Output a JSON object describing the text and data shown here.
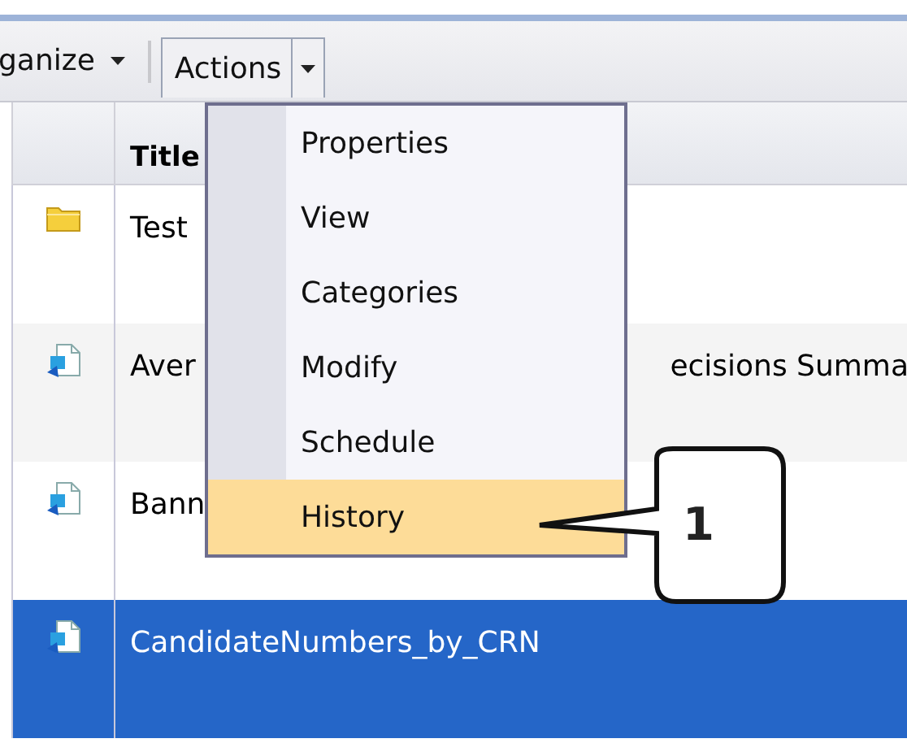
{
  "toolbar": {
    "buttons": [
      {
        "label": "ganize",
        "kind": "dropdown"
      },
      {
        "label": "Actions",
        "kind": "split"
      }
    ]
  },
  "table": {
    "columns": [
      "Title"
    ],
    "rows": [
      {
        "kind": "folder",
        "title": "Test",
        "selected": false
      },
      {
        "kind": "report",
        "title": "Aver",
        "title_right": "ecisions Summa",
        "selected": false
      },
      {
        "kind": "report",
        "title": "Bann",
        "selected": false
      },
      {
        "kind": "report",
        "title": "CandidateNumbers_by_CRN",
        "selected": true
      }
    ]
  },
  "menu": {
    "items": [
      {
        "label": "Properties",
        "selected": false
      },
      {
        "label": "View",
        "selected": false
      },
      {
        "label": "Categories",
        "selected": false
      },
      {
        "label": "Modify",
        "selected": false
      },
      {
        "label": "Schedule",
        "selected": false
      },
      {
        "label": "History",
        "selected": true
      }
    ]
  },
  "callout": {
    "label": "1"
  }
}
